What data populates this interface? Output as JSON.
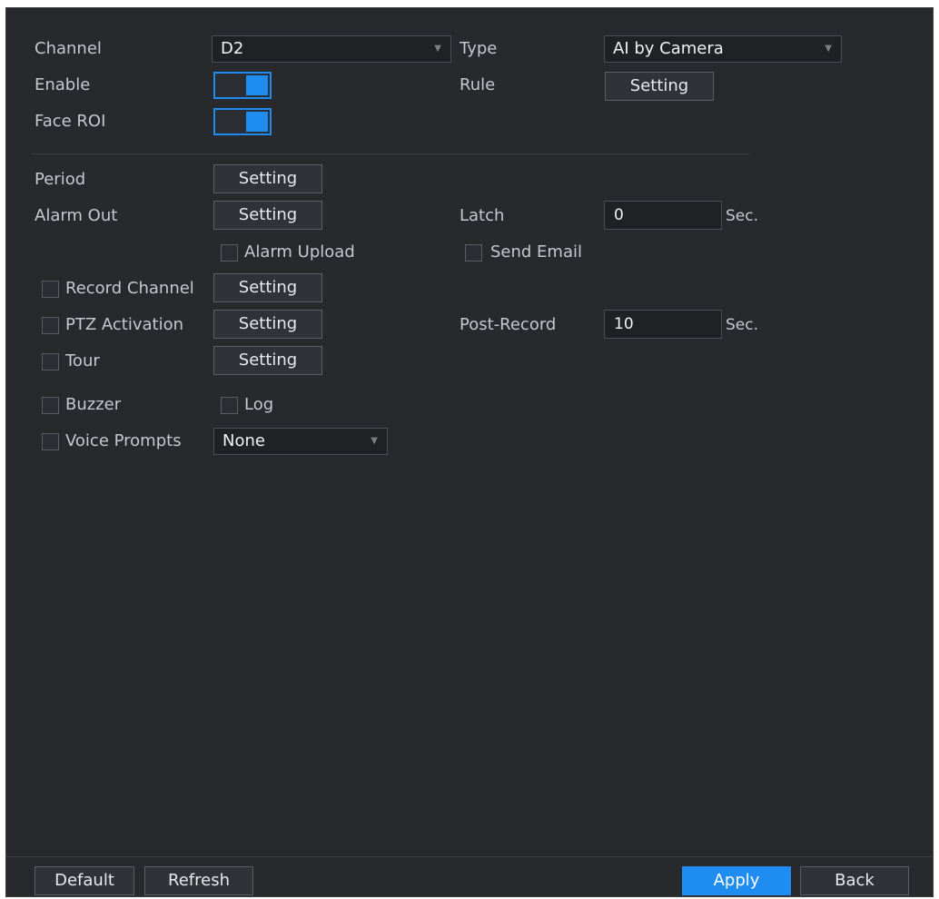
{
  "channel": {
    "label": "Channel",
    "value": "D2"
  },
  "type": {
    "label": "Type",
    "value": "AI by Camera"
  },
  "enable": {
    "label": "Enable",
    "on": true
  },
  "rule": {
    "label": "Rule",
    "button": "Setting"
  },
  "face_roi": {
    "label": "Face ROI",
    "on": true
  },
  "period": {
    "label": "Period",
    "button": "Setting"
  },
  "alarm_out": {
    "label": "Alarm Out",
    "button": "Setting"
  },
  "latch": {
    "label": "Latch",
    "value": "0",
    "unit": "Sec."
  },
  "alarm_upload": {
    "label": "Alarm Upload",
    "checked": false
  },
  "send_email": {
    "label": "Send Email",
    "checked": false
  },
  "record_channel": {
    "label": "Record Channel",
    "button": "Setting",
    "checked": false
  },
  "ptz_activation": {
    "label": "PTZ Activation",
    "button": "Setting",
    "checked": false
  },
  "post_record": {
    "label": "Post-Record",
    "value": "10",
    "unit": "Sec."
  },
  "tour": {
    "label": "Tour",
    "button": "Setting",
    "checked": false
  },
  "buzzer": {
    "label": "Buzzer",
    "checked": false
  },
  "log": {
    "label": "Log",
    "checked": false
  },
  "voice_prompts": {
    "label": "Voice Prompts",
    "value": "None",
    "checked": false
  },
  "footer": {
    "default": "Default",
    "refresh": "Refresh",
    "apply": "Apply",
    "back": "Back"
  },
  "colors": {
    "accent": "#1e8cf0",
    "panel_bg": "#27292d"
  }
}
